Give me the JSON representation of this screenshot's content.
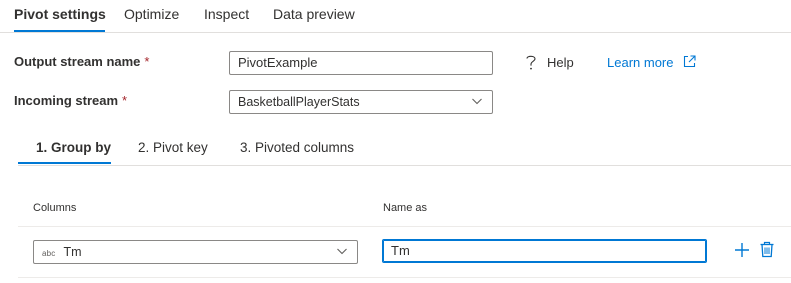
{
  "top_tabs": [
    {
      "label": "Pivot settings",
      "active": true
    },
    {
      "label": "Optimize",
      "active": false
    },
    {
      "label": "Inspect",
      "active": false
    },
    {
      "label": "Data preview",
      "active": false
    }
  ],
  "form": {
    "output_stream": {
      "label": "Output stream name",
      "required_mark": "*",
      "value": "PivotExample"
    },
    "incoming_stream": {
      "label": "Incoming stream",
      "required_mark": "*",
      "value": "BasketballPlayerStats"
    },
    "help": {
      "icon": "question-icon",
      "label": "Help"
    },
    "learn_more": {
      "label": "Learn more",
      "icon": "external-link-icon"
    }
  },
  "sub_tabs": [
    {
      "label": "1. Group by",
      "active": true
    },
    {
      "label": "2. Pivot key",
      "active": false
    },
    {
      "label": "3. Pivoted columns",
      "active": false
    }
  ],
  "group_by": {
    "headers": {
      "columns": "Columns",
      "name_as": "Name as"
    },
    "rows": [
      {
        "type_badge": "abc",
        "column": "Tm",
        "name_as": "Tm"
      }
    ],
    "actions": {
      "add_icon": "plus-icon",
      "delete_icon": "trash-icon"
    }
  },
  "colors": {
    "accent": "#0078d4",
    "required": "#a4262c",
    "text": "#323130"
  }
}
